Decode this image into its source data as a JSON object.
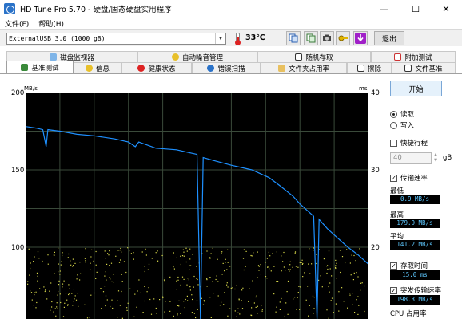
{
  "window": {
    "title": "HD Tune Pro 5.70 - 硬盘/固态硬盘实用程序",
    "minimize": "—",
    "maximize": "☐",
    "close": "✕"
  },
  "menu": [
    "文件(F)",
    "帮助(H)"
  ],
  "toolbar": {
    "drive": "ExternalUSB 3.0 (1000 gB)",
    "temperature": "33℃",
    "exit_label": "退出",
    "buttons": [
      "copy-info-icon",
      "copy-screen-icon",
      "camera-icon",
      "key-icon",
      "download-icon"
    ]
  },
  "tabs": {
    "row1": [
      "磁盘监视器",
      "自动噪音管理",
      "随机存取",
      "附加测试"
    ],
    "row2": [
      "基准测试",
      "信息",
      "健康状态",
      "错误扫描",
      "文件夹占用率",
      "擦除",
      "文件基准"
    ]
  },
  "controls": {
    "start": "开始",
    "read": "读取",
    "write": "写入",
    "quick_label": "快捷行程",
    "quick_value": "40",
    "quick_unit": "gB",
    "transfer_rate": "传输速率",
    "min_label": "最低",
    "min_value": "0.9 MB/s",
    "max_label": "最高",
    "max_value": "179.9 MB/s",
    "avg_label": "平均",
    "avg_value": "141.2 MB/s",
    "access_time": "存取时间",
    "access_value": "15.0 ms",
    "burst_rate": "突发传输速率",
    "burst_value": "198.3 MB/s",
    "cpu_label": "CPU 占用率"
  },
  "colors": {
    "plot_bg": "#000000",
    "grid": "#3a4a3a",
    "transfer_line": "#1e90ff",
    "access_dots": "#d8d84a",
    "stat_text": "#5ec8ff"
  },
  "chart_data": {
    "type": "line",
    "left_unit": "MB/s",
    "right_unit": "ms",
    "left_ticks": [
      200,
      150,
      100
    ],
    "right_ticks": [
      40,
      30,
      20
    ],
    "ylim_left": [
      50,
      200
    ],
    "ylim_right": [
      10,
      40
    ],
    "series": [
      {
        "values": [
          [
            0,
            178
          ],
          [
            3,
            177
          ],
          [
            5,
            176
          ],
          [
            6,
            165
          ],
          [
            6.5,
            176
          ],
          [
            10,
            175
          ],
          [
            15,
            173
          ],
          [
            20,
            172
          ],
          [
            26,
            170
          ],
          [
            30,
            168
          ],
          [
            32,
            165
          ],
          [
            33,
            168
          ],
          [
            38,
            164
          ],
          [
            44,
            163
          ],
          [
            48,
            161
          ],
          [
            50,
            160
          ],
          [
            51,
            40
          ],
          [
            51.8,
            158
          ],
          [
            55,
            156
          ],
          [
            60,
            153
          ],
          [
            66,
            150
          ],
          [
            71,
            145
          ],
          [
            74,
            140
          ],
          [
            78,
            133
          ],
          [
            80,
            128
          ],
          [
            82,
            124
          ],
          [
            84,
            120
          ],
          [
            85,
            40
          ],
          [
            85.6,
            118
          ],
          [
            88,
            112
          ],
          [
            91,
            106
          ],
          [
            94,
            100
          ],
          [
            97,
            95
          ],
          [
            100,
            89
          ]
        ]
      }
    ],
    "access_scatter_range_ms": [
      10,
      20
    ]
  }
}
